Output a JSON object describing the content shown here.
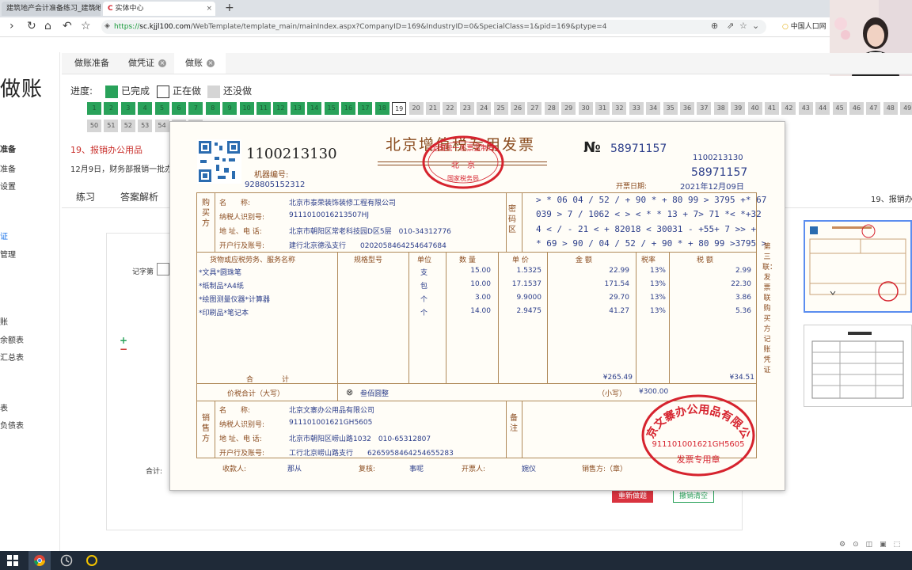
{
  "browser": {
    "tabs": [
      {
        "label": "建筑地产会计准备练习_建筑地...",
        "active": false
      },
      {
        "label": "实体中心",
        "active": true
      }
    ],
    "new_tab": "+",
    "url_host": "sc.kjjl100.com",
    "url_scheme": "https://",
    "url_path": "/WebTemplate/template_main/mainIndex.aspx?CompanyID=169&IndustryID=0&SpecialClass=1&pid=169&ptype=4",
    "bookmark": "中国人口网"
  },
  "sidebar": {
    "logo": "做账",
    "items": [
      {
        "label": "准备",
        "active": false
      },
      {
        "label": "准备",
        "active": false
      },
      {
        "label": "设置",
        "active": false
      },
      {
        "label": "证",
        "active": true
      },
      {
        "label": "管理",
        "active": false
      },
      {
        "label": "账",
        "active": false
      },
      {
        "label": "余额表",
        "active": false
      },
      {
        "label": "汇总表",
        "active": false
      },
      {
        "label": "表",
        "active": false
      },
      {
        "label": "负债表",
        "active": false
      }
    ]
  },
  "app_tabs": [
    {
      "label": "做账准备",
      "closable": false,
      "active": false
    },
    {
      "label": "做凭证",
      "closable": true,
      "active": false
    },
    {
      "label": "做账",
      "closable": true,
      "active": true
    }
  ],
  "progress": {
    "label": "进度:",
    "legend": {
      "done": "已完成",
      "current": "正在做",
      "todo": "还没做"
    },
    "colors": {
      "done": "#29a25a",
      "current": "#ffffff",
      "todo": "#d5d5d5"
    },
    "done_count": 18,
    "current": 19,
    "total": 56
  },
  "task": {
    "title": "19、报销办公用品",
    "desc": "12月9日，财务部报销一批办公用品",
    "right_title": "19、报销办"
  },
  "subtabs": [
    "练习",
    "答案解析"
  ],
  "work": {
    "voucher_word": "记字第",
    "plus": "+",
    "minus": "−",
    "total_label": "合计:",
    "redo_button": "重新做题",
    "clear_button": "撤销清空"
  },
  "invoice": {
    "code": "1100213130",
    "machine_label": "机器编号:",
    "machine_no": "928805152312",
    "title": "北京增值税专用发票",
    "no_mark": "№",
    "no": "58971157",
    "code_right": "1100213130",
    "no_right": "58971157",
    "date_label": "开票日期:",
    "date": "2021年12月09日",
    "buyer_vert": "购买方",
    "buyer": {
      "name_label": "名　　称:",
      "name": "北京市泰荣装饰装修工程有限公司",
      "tax_label": "纳税人识别号:",
      "tax_id": "911101001621350​7HJ",
      "addr_label": "地 址、电 话:",
      "addr": "北京市朝阳区常老科技园D区5层　010-34312776",
      "bank_label": "开户行及账号:",
      "bank": "建行北京德泓支行　　0202058464254647684"
    },
    "cipher_vert": "密码区",
    "cipher": [
      "> * 06 04 / 52 / + 90 * + 80 99 > 3795 +* 67",
      "039 > 7 / 1062 < > < * * 13 + 7> 71 *< *+32",
      "4 < / - 21 < + 82018 < 30031 - +55+ 7 >> +",
      "* 69 > 90 / 04 / 52 / + 90 * + 80 99 >3795 >"
    ],
    "columns": [
      "货物或应税劳务、服务名称",
      "规格型号",
      "单位",
      "数 量",
      "单 价",
      "金 额",
      "税率",
      "税 额"
    ],
    "items": [
      {
        "name": "*文具*圆珠笔",
        "spec": "",
        "unit": "支",
        "qty": "15.00",
        "price": "1.5325",
        "amount": "22.99",
        "rate": "13%",
        "tax": "2.99"
      },
      {
        "name": "*纸制品*A4纸",
        "spec": "",
        "unit": "包",
        "qty": "10.00",
        "price": "17.1537",
        "amount": "171.54",
        "rate": "13%",
        "tax": "22.30"
      },
      {
        "name": "*绘图测量仪器*计算器",
        "spec": "",
        "unit": "个",
        "qty": "3.00",
        "price": "9.9000",
        "amount": "29.70",
        "rate": "13%",
        "tax": "3.86"
      },
      {
        "name": "*印刷品*笔记本",
        "spec": "",
        "unit": "个",
        "qty": "14.00",
        "price": "2.9475",
        "amount": "41.27",
        "rate": "13%",
        "tax": "5.36"
      }
    ],
    "total_label": "合　　　　计",
    "total_amount": "¥265.49",
    "total_tax": "¥34.51",
    "sum_label": "价税合计（大写）",
    "sum_words_mark": "⊗",
    "sum_words": "叁佰圆整",
    "sum_small_label": "（小写）",
    "sum_small": "¥300.00",
    "seller_vert": "销售方",
    "seller": {
      "name_label": "名　　称:",
      "name": "北京文寨办公用品有限公司",
      "tax_label": "纳税人识别号:",
      "tax_id": "911101001621GH5605",
      "addr_label": "地 址、电 话:",
      "addr": "北京市朝阳区崂山路1032　010-65312807",
      "bank_label": "开户行及账号:",
      "bank": "工行北京崂山路支行　　6265958464254655283"
    },
    "remark_vert": "备注",
    "side_note": "第三联：发票联　购买方记账凭证",
    "payee_label": "收款人:",
    "payee": "那从",
    "reviewer_label": "复核:",
    "reviewer": "事呢",
    "drawer_label": "开票人:",
    "drawer": "婉仪",
    "seller_seal_label": "销售方:（章）",
    "stamp_bottom": {
      "company": "北京文寨办公用品有限公司",
      "tax_id": "911101001621GH5605",
      "type": "发票专用章"
    },
    "stamp_top": {
      "text": "全国统一发票监制章",
      "city": "北京",
      "bureau": "国家税务局"
    }
  },
  "colors": {
    "accent_red": "#c9302c",
    "invoice_brown": "#8a4b1e",
    "invoice_blue": "#2c3e8a",
    "stamp_red": "#d6232e"
  }
}
